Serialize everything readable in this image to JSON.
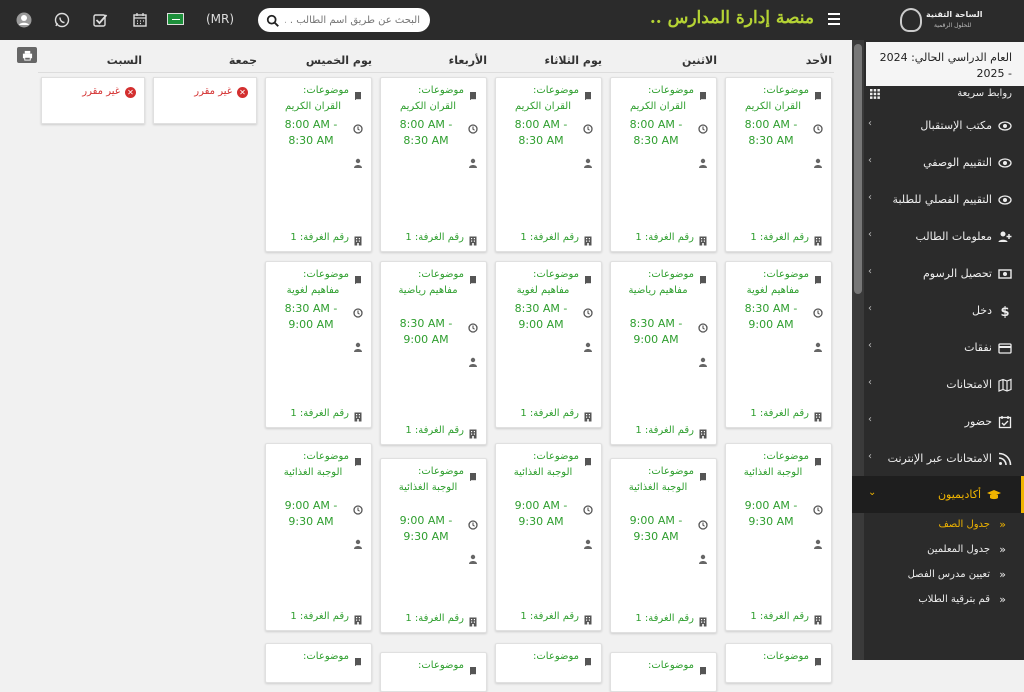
{
  "topbar": {
    "brand_title": "منصة إدارة المدارس ..",
    "search_placeholder": "البحث عن طريق اسم الطالب . .",
    "language_label": "(MR)",
    "logo_title": "الساحة التقنية",
    "logo_subtitle": "للحلول الرقمية"
  },
  "sidebar": {
    "academic_year": "العام الدراسي الحالي: 2024 - 2025",
    "quick_links": "روابط سريعة",
    "items": [
      {
        "label": "مكتب الإستقبال",
        "icon": "eye-icon"
      },
      {
        "label": "التقييم الوصفي",
        "icon": "eye-icon"
      },
      {
        "label": "التقييم الفصلي للطلبة",
        "icon": "eye-icon"
      },
      {
        "label": "معلومات الطالب",
        "icon": "user-plus-icon"
      },
      {
        "label": "تحصيل الرسوم",
        "icon": "money-icon"
      },
      {
        "label": "دخل",
        "icon": "dollar-icon"
      },
      {
        "label": "نفقات",
        "icon": "credit-card-icon"
      },
      {
        "label": "الامتحانات",
        "icon": "map-icon"
      },
      {
        "label": "حضور",
        "icon": "calendar-check-icon"
      },
      {
        "label": "الامتحانات عبر الإنترنت",
        "icon": "rss-icon"
      },
      {
        "label": "أكاديميون",
        "icon": "graduation-cap-icon"
      }
    ],
    "sub_items": [
      {
        "label": "جدول الصف"
      },
      {
        "label": "جدول المعلمين"
      },
      {
        "label": "تعيين مدرس الفصل"
      },
      {
        "label": "قم بترقية الطلاب"
      }
    ]
  },
  "timetable": {
    "days": [
      "الأحد",
      "الاثنين",
      "يوم الثلاثاء",
      "الأربعاء",
      "يوم الخميس",
      "جمعة",
      "السبت"
    ],
    "subject_label": "موضوعات:",
    "room_label": "رقم الغرفة: 1",
    "off_label": "غير مقرر",
    "rows": [
      {
        "subject": "القران الكريم",
        "time": "8:00 AM - 8:30 AM"
      },
      {
        "subject": "مفاهيم لغوية",
        "time": "8:30 AM - 9:00 AM"
      },
      {
        "subject": "الوجبة الغذائية",
        "time": "9:00 AM - 9:30 AM"
      }
    ],
    "row1_alt_subject": "مفاهيم رياضية",
    "row4_subject_label": "موضوعات:"
  },
  "colors": {
    "accent": "#b5d334",
    "active": "#f0b400",
    "subject_green": "#2e9e2e",
    "off_red": "#d32f2f"
  }
}
